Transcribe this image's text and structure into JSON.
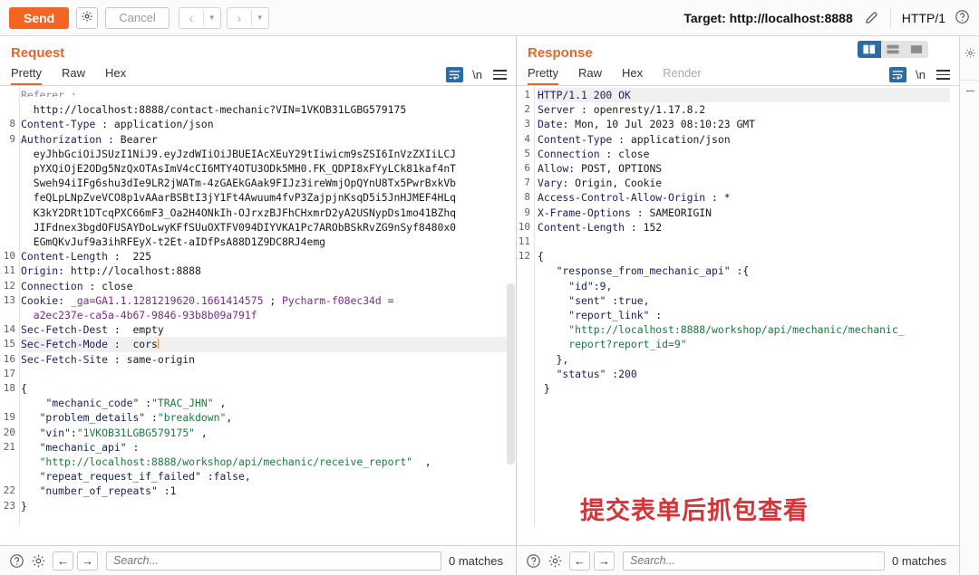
{
  "toolbar": {
    "send_label": "Send",
    "settings_icon": "gear-icon",
    "cancel_label": "Cancel",
    "prev_icon": "chevron-left-icon",
    "next_icon": "chevron-right-icon",
    "caret_icon": "caret-down-icon",
    "target_label": "Target: http://localhost:8888",
    "edit_icon": "pencil-icon",
    "http_version": "HTTP/1",
    "help_icon": "help-circle-icon"
  },
  "request": {
    "title": "Request",
    "tabs": [
      {
        "label": "Pretty",
        "active": true,
        "disabled": false
      },
      {
        "label": "Raw",
        "active": false,
        "disabled": false
      },
      {
        "label": "Hex",
        "active": false,
        "disabled": false
      }
    ],
    "tools": {
      "wrap_icon": "word-wrap-icon",
      "newline_label": "\\n",
      "menu_icon": "hamburger-menu-icon"
    },
    "lines": [
      {
        "n": "",
        "segs": [
          {
            "t": "Referer :",
            "c": "k-hdr"
          }
        ],
        "clip": true
      },
      {
        "n": "",
        "segs": [
          {
            "t": "  http://localhost:8888/contact-mechanic?VIN=1VKOB31LGBG579175",
            "c": "k-val"
          }
        ]
      },
      {
        "n": "8",
        "segs": [
          {
            "t": "Content-Type",
            "c": "k-hdr"
          },
          {
            "t": " : ",
            "c": "k-plain"
          },
          {
            "t": "application/json",
            "c": "k-val"
          }
        ]
      },
      {
        "n": "9",
        "segs": [
          {
            "t": "Authorization",
            "c": "k-hdr"
          },
          {
            "t": " : ",
            "c": "k-plain"
          },
          {
            "t": "Bearer",
            "c": "k-val"
          }
        ]
      },
      {
        "n": "",
        "segs": [
          {
            "t": "  eyJhbGciOiJSUzI1NiJ9.eyJzdWIiOiJBUEIAcXEuY29tIiwicm9sZSI6InVzZXIiLCJ",
            "c": "k-b64"
          }
        ]
      },
      {
        "n": "",
        "segs": [
          {
            "t": "  pYXQiOjE2ODg5NzQxOTAsImV4cCI6MTY4OTU3ODk5MH0.FK_QDPI8xFYyLCk81kaf4nT",
            "c": "k-b64"
          }
        ]
      },
      {
        "n": "",
        "segs": [
          {
            "t": "  Sweh94iIFg6shu3dIe9LR2jWATm-4zGAEkGAak9FIJz3ireWmjOpQYnU8Tx5PwrBxkVb",
            "c": "k-b64"
          }
        ]
      },
      {
        "n": "",
        "segs": [
          {
            "t": "  feQLpLNpZveVCO8p1vAAarBSBtI3jY1Ft4Awuum4fvP3ZajpjnKsqD5i5JnHJMEF4HLq",
            "c": "k-b64"
          }
        ]
      },
      {
        "n": "",
        "segs": [
          {
            "t": "  K3kY2DRt1DTcqPXC66mF3_Oa2H4ONkIh-OJrxzBJFhCHxmrD2yA2USNypDs1mo41BZhq",
            "c": "k-b64"
          }
        ]
      },
      {
        "n": "",
        "segs": [
          {
            "t": "  JIFdnex3bgdOFUSAYDoLwyKFfSUuOXTFV094DIYVKA1Pc7ARObBSkRvZG9nSyf8480x0",
            "c": "k-b64"
          }
        ]
      },
      {
        "n": "",
        "segs": [
          {
            "t": "  EGmQKvJuf9a3ihRFEyX-t2Et-aIDfPsA88D1Z9DC8RJ4emg",
            "c": "k-b64"
          }
        ]
      },
      {
        "n": "10",
        "segs": [
          {
            "t": "Content-Length",
            "c": "k-hdr"
          },
          {
            "t": " :  225",
            "c": "k-val"
          }
        ]
      },
      {
        "n": "11",
        "segs": [
          {
            "t": "Origin",
            "c": "k-hdr"
          },
          {
            "t": ": http://localhost:8888",
            "c": "k-val"
          }
        ]
      },
      {
        "n": "12",
        "segs": [
          {
            "t": "Connection",
            "c": "k-hdr"
          },
          {
            "t": " : close",
            "c": "k-val"
          }
        ]
      },
      {
        "n": "13",
        "segs": [
          {
            "t": "Cookie",
            "c": "k-hdr"
          },
          {
            "t": ": ",
            "c": "k-plain"
          },
          {
            "t": "_ga=GA1.1.1281219620.1661414575",
            "c": "k-ck"
          },
          {
            "t": " ; ",
            "c": "k-plain"
          },
          {
            "t": "Pycharm-f08ec34d =",
            "c": "k-ck"
          }
        ]
      },
      {
        "n": "",
        "segs": [
          {
            "t": "  a2ec237e-ca5a-4b67-9846-93b8b09a791f",
            "c": "k-ck"
          }
        ]
      },
      {
        "n": "14",
        "segs": [
          {
            "t": "Sec-Fetch-Dest",
            "c": "k-hdr"
          },
          {
            "t": " :  empty",
            "c": "k-val"
          }
        ]
      },
      {
        "n": "15",
        "segs": [
          {
            "t": "Sec-Fetch-Mode",
            "c": "k-hdr"
          },
          {
            "t": " :  cors",
            "c": "k-val"
          }
        ],
        "hl": true,
        "cursor": true
      },
      {
        "n": "16",
        "segs": [
          {
            "t": "Sec-Fetch-Site",
            "c": "k-hdr"
          },
          {
            "t": " : same-origin",
            "c": "k-val"
          }
        ]
      },
      {
        "n": "17",
        "segs": [
          {
            "t": "",
            "c": "k-plain"
          }
        ]
      },
      {
        "n": "18",
        "segs": [
          {
            "t": "{",
            "c": "k-plain"
          }
        ]
      },
      {
        "n": "",
        "segs": [
          {
            "t": "    ",
            "c": "k-plain"
          },
          {
            "t": "\"mechanic_code\"",
            "c": "k-key"
          },
          {
            "t": " :",
            "c": "k-plain"
          },
          {
            "t": "\"TRAC_JHN\"",
            "c": "k-str"
          },
          {
            "t": " ,",
            "c": "k-plain"
          }
        ]
      },
      {
        "n": "19",
        "segs": [
          {
            "t": "   ",
            "c": "k-plain"
          },
          {
            "t": "\"problem_details\"",
            "c": "k-key"
          },
          {
            "t": " :",
            "c": "k-plain"
          },
          {
            "t": "\"breakdown\"",
            "c": "k-str"
          },
          {
            "t": ",",
            "c": "k-plain"
          }
        ]
      },
      {
        "n": "20",
        "segs": [
          {
            "t": "   ",
            "c": "k-plain"
          },
          {
            "t": "\"vin\"",
            "c": "k-key"
          },
          {
            "t": ":",
            "c": "k-plain"
          },
          {
            "t": "\"1VKOB31LGBG579175\"",
            "c": "k-str"
          },
          {
            "t": " ,",
            "c": "k-plain"
          }
        ]
      },
      {
        "n": "21",
        "segs": [
          {
            "t": "   ",
            "c": "k-plain"
          },
          {
            "t": "\"mechanic_api\"",
            "c": "k-key"
          },
          {
            "t": " :",
            "c": "k-plain"
          }
        ]
      },
      {
        "n": "",
        "segs": [
          {
            "t": "   ",
            "c": "k-plain"
          },
          {
            "t": "\"http://localhost:8888/workshop/api/mechanic/receive_report\"",
            "c": "k-str"
          },
          {
            "t": "  ,",
            "c": "k-plain"
          }
        ]
      },
      {
        "n": "",
        "segs": [
          {
            "t": "   ",
            "c": "k-plain"
          },
          {
            "t": "\"repeat_request_if_failed\"",
            "c": "k-key"
          },
          {
            "t": " :",
            "c": "k-plain"
          },
          {
            "t": "false,",
            "c": "k-num"
          }
        ]
      },
      {
        "n": "22",
        "segs": [
          {
            "t": "   ",
            "c": "k-plain"
          },
          {
            "t": "\"number_of_repeats\"",
            "c": "k-key"
          },
          {
            "t": " :",
            "c": "k-plain"
          },
          {
            "t": "1",
            "c": "k-num"
          }
        ]
      },
      {
        "n": "23",
        "segs": [
          {
            "t": "}",
            "c": "k-plain"
          }
        ]
      }
    ],
    "statusbar": {
      "help_icon": "help-circle-icon",
      "settings_icon": "gear-icon",
      "back_icon": "arrow-left-icon",
      "forward_icon": "arrow-right-icon",
      "search_placeholder": "Search...",
      "search_value": "",
      "matches": "0 matches"
    }
  },
  "response": {
    "title": "Response",
    "tabs": [
      {
        "label": "Pretty",
        "active": true,
        "disabled": false
      },
      {
        "label": "Raw",
        "active": false,
        "disabled": false
      },
      {
        "label": "Hex",
        "active": false,
        "disabled": false
      },
      {
        "label": "Render",
        "active": false,
        "disabled": true
      }
    ],
    "view_toggle": [
      {
        "name": "split-vertical-view",
        "on": true
      },
      {
        "name": "split-horizontal-view",
        "on": false
      },
      {
        "name": "single-pane-view",
        "on": false
      }
    ],
    "tools": {
      "wrap_icon": "word-wrap-icon",
      "newline_label": "\\n",
      "menu_icon": "hamburger-menu-icon"
    },
    "lines": [
      {
        "n": "1",
        "segs": [
          {
            "t": "HTTP/1.1 200 OK",
            "c": "k-hdr"
          }
        ],
        "hl": true
      },
      {
        "n": "2",
        "segs": [
          {
            "t": "Server",
            "c": "k-hdr"
          },
          {
            "t": " : openresty/1.17.8.2",
            "c": "k-val"
          }
        ]
      },
      {
        "n": "3",
        "segs": [
          {
            "t": "Date",
            "c": "k-hdr"
          },
          {
            "t": ": Mon, 10 Jul 2023 08:10:23 GMT",
            "c": "k-val"
          }
        ]
      },
      {
        "n": "4",
        "segs": [
          {
            "t": "Content-Type",
            "c": "k-hdr"
          },
          {
            "t": " : application/json",
            "c": "k-val"
          }
        ]
      },
      {
        "n": "5",
        "segs": [
          {
            "t": "Connection",
            "c": "k-hdr"
          },
          {
            "t": " : close",
            "c": "k-val"
          }
        ]
      },
      {
        "n": "6",
        "segs": [
          {
            "t": "Allow",
            "c": "k-hdr"
          },
          {
            "t": ": POST, OPTIONS",
            "c": "k-val"
          }
        ]
      },
      {
        "n": "7",
        "segs": [
          {
            "t": "Vary",
            "c": "k-hdr"
          },
          {
            "t": ": Origin, Cookie",
            "c": "k-val"
          }
        ]
      },
      {
        "n": "8",
        "segs": [
          {
            "t": "Access-Control-Allow-Origin",
            "c": "k-hdr"
          },
          {
            "t": " : *",
            "c": "k-val"
          }
        ]
      },
      {
        "n": "9",
        "segs": [
          {
            "t": "X-Frame-Options",
            "c": "k-hdr"
          },
          {
            "t": " : SAMEORIGIN",
            "c": "k-val"
          }
        ]
      },
      {
        "n": "10",
        "segs": [
          {
            "t": "Content-Length",
            "c": "k-hdr"
          },
          {
            "t": " : 152",
            "c": "k-val"
          }
        ]
      },
      {
        "n": "11",
        "segs": [
          {
            "t": "",
            "c": "k-plain"
          }
        ]
      },
      {
        "n": "12",
        "segs": [
          {
            "t": "{",
            "c": "k-plain"
          }
        ]
      },
      {
        "n": "",
        "segs": [
          {
            "t": "   ",
            "c": "k-plain"
          },
          {
            "t": "\"response_from_mechanic_api\"",
            "c": "k-key"
          },
          {
            "t": " :{",
            "c": "k-plain"
          }
        ]
      },
      {
        "n": "",
        "segs": [
          {
            "t": "     ",
            "c": "k-plain"
          },
          {
            "t": "\"id\"",
            "c": "k-key"
          },
          {
            "t": ":",
            "c": "k-plain"
          },
          {
            "t": "9,",
            "c": "k-num"
          }
        ]
      },
      {
        "n": "",
        "segs": [
          {
            "t": "     ",
            "c": "k-plain"
          },
          {
            "t": "\"sent\"",
            "c": "k-key"
          },
          {
            "t": " :",
            "c": "k-plain"
          },
          {
            "t": "true,",
            "c": "k-num"
          }
        ]
      },
      {
        "n": "",
        "segs": [
          {
            "t": "     ",
            "c": "k-plain"
          },
          {
            "t": "\"report_link\"",
            "c": "k-key"
          },
          {
            "t": " :",
            "c": "k-plain"
          }
        ]
      },
      {
        "n": "",
        "segs": [
          {
            "t": "     ",
            "c": "k-plain"
          },
          {
            "t": "\"http://localhost:8888/workshop/api/mechanic/mechanic_",
            "c": "k-str"
          }
        ]
      },
      {
        "n": "",
        "segs": [
          {
            "t": "     ",
            "c": "k-plain"
          },
          {
            "t": "report?report_id=9\"",
            "c": "k-str"
          }
        ]
      },
      {
        "n": "",
        "segs": [
          {
            "t": "   },",
            "c": "k-plain"
          }
        ]
      },
      {
        "n": "",
        "segs": [
          {
            "t": "   ",
            "c": "k-plain"
          },
          {
            "t": "\"status\"",
            "c": "k-key"
          },
          {
            "t": " :",
            "c": "k-plain"
          },
          {
            "t": "200",
            "c": "k-num"
          }
        ]
      },
      {
        "n": "",
        "segs": [
          {
            "t": " }",
            "c": "k-plain"
          }
        ]
      }
    ],
    "annotation": "提交表单后抓包查看",
    "annotation_color": "#d4353a",
    "statusbar": {
      "help_icon": "help-circle-icon",
      "settings_icon": "gear-icon",
      "back_icon": "arrow-left-icon",
      "forward_icon": "arrow-right-icon",
      "search_placeholder": "Search...",
      "search_value": "",
      "matches": "0 matches"
    }
  },
  "colors": {
    "accent_orange": "#f26522",
    "panel_title": "#e8662a",
    "header_name": "#1d1d5e",
    "json_key": "#16205e",
    "json_string": "#197a3d",
    "cookie": "#7a2b8a",
    "active_toggle": "#2b6ca3"
  }
}
